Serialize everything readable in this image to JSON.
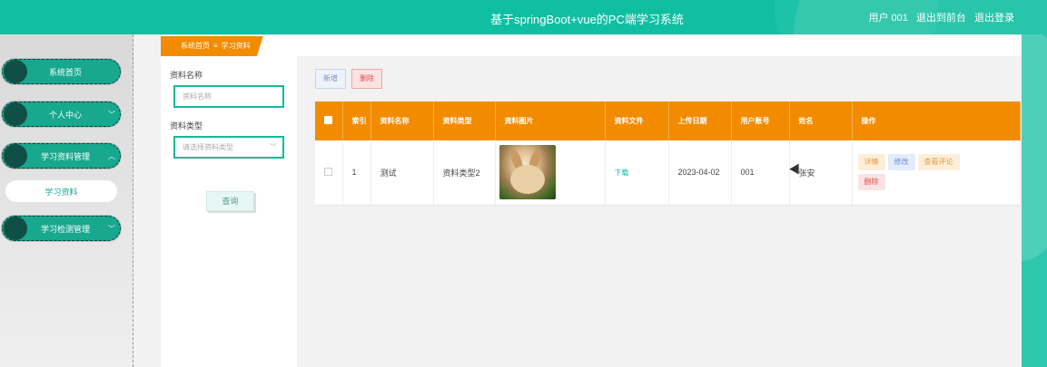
{
  "header": {
    "title": "基于springBoot+vue的PC端学习系统",
    "user_label": "用户 001",
    "exit_backend": "退出到前台",
    "logout": "退出登录"
  },
  "sidebar": {
    "items": [
      {
        "label": "系统首页",
        "has_chevron": false
      },
      {
        "label": "个人中心",
        "has_chevron": true,
        "chevron": "chevron-down"
      },
      {
        "label": "学习资料管理",
        "has_chevron": true,
        "chevron": "chevron-up"
      },
      {
        "label": "学习检测管理",
        "has_chevron": true,
        "chevron": "chevron-down"
      }
    ],
    "sub_item": "学习资料"
  },
  "breadcrumb": {
    "home": "系统首页",
    "separator": "≡",
    "current": "学习资料"
  },
  "search": {
    "name_label": "资料名称",
    "name_placeholder": "资料名称",
    "type_label": "资料类型",
    "type_placeholder": "请选择资料类型",
    "query_button": "查询"
  },
  "toolbar": {
    "add_label": "新增",
    "delete_label": "删除"
  },
  "table": {
    "columns": [
      "",
      "索引",
      "资料名称",
      "资料类型",
      "资料图片",
      "资料文件",
      "上传日期",
      "用户账号",
      "姓名",
      "操作"
    ],
    "rows": [
      {
        "index": "1",
        "name": "测试",
        "type": "资料类型2",
        "file": "下载",
        "date": "2023-04-02",
        "account": "001",
        "realname": "张安"
      }
    ],
    "actions": {
      "detail": "详情",
      "edit": "修改",
      "comments": "查看评论",
      "delete": "删除"
    }
  },
  "colors": {
    "primary": "#10bfa2",
    "accent": "#f28b00"
  }
}
